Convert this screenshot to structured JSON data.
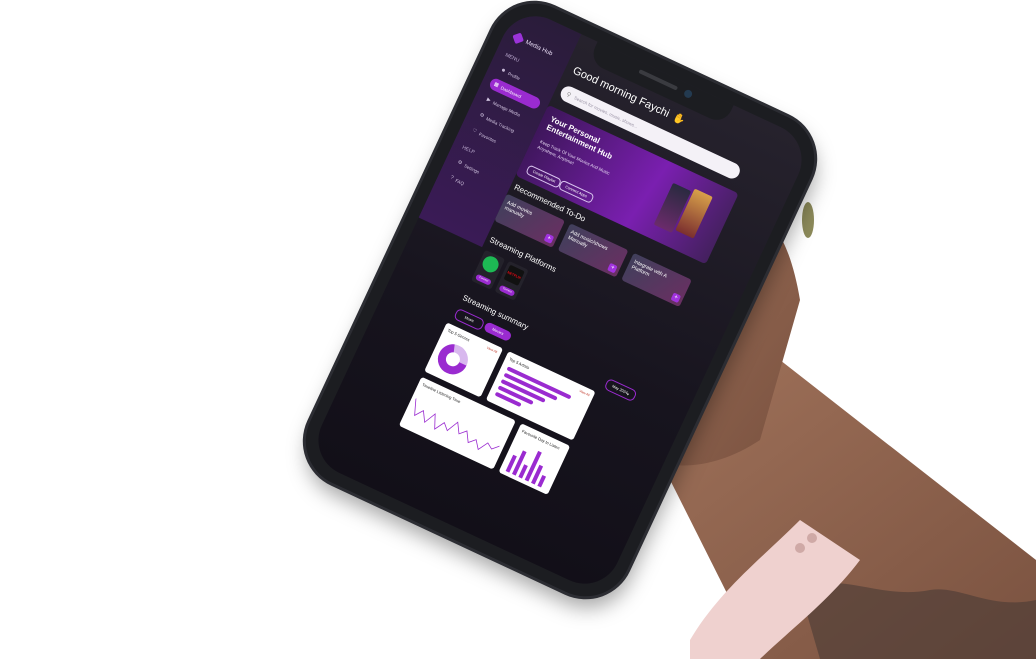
{
  "app": {
    "name": "Media Hub"
  },
  "sidebar": {
    "menu_label": "MENU",
    "items": [
      {
        "label": "Profile",
        "icon": "person-icon"
      },
      {
        "label": "Dashboard",
        "icon": "dashboard-icon",
        "active": true
      },
      {
        "label": "Manage Media",
        "icon": "media-icon"
      },
      {
        "label": "Media Tracking",
        "icon": "tracking-icon"
      },
      {
        "label": "Favorites",
        "icon": "heart-icon"
      }
    ],
    "help_label": "HELP",
    "help_items": [
      {
        "label": "Settings",
        "icon": "gear-icon"
      },
      {
        "label": "FAQ",
        "icon": "question-icon"
      }
    ]
  },
  "main": {
    "greeting": "Good morning Faychi",
    "search_placeholder": "Search for movies, music, shows...",
    "hero": {
      "title": "Your Personal Entertainment Hub",
      "subtitle": "Keep Track Of Your Movies And Music Anywhere, Anytime!",
      "button_1": "Create Playlist",
      "button_2": "Connect Apps"
    },
    "todo_title": "Recommended To-Do",
    "todos": [
      {
        "label": "Add movies manually"
      },
      {
        "label": "Add music/shows Manually"
      },
      {
        "label": "Integrate with A Platform"
      }
    ],
    "platforms_title": "Streaming Platforms",
    "platforms": [
      {
        "name": "Spotify",
        "button": "Connect"
      },
      {
        "name": "NETFLIX",
        "button": "Connect"
      }
    ],
    "summary": {
      "title": "Streaming summary",
      "toggle_music": "Music",
      "toggle_movies": "Movies",
      "period": "May 2024",
      "panels": {
        "top_genres": "Top 5 Genres",
        "top_artists": "Top 5 Artists",
        "timeline": "Timeline Listening Time",
        "favorite_day": "Favourite Day to Listen"
      },
      "view_all": "View All"
    }
  },
  "colors": {
    "accent": "#9a2bd0",
    "background": "#17141e",
    "sidebar": "#3a1b56"
  }
}
